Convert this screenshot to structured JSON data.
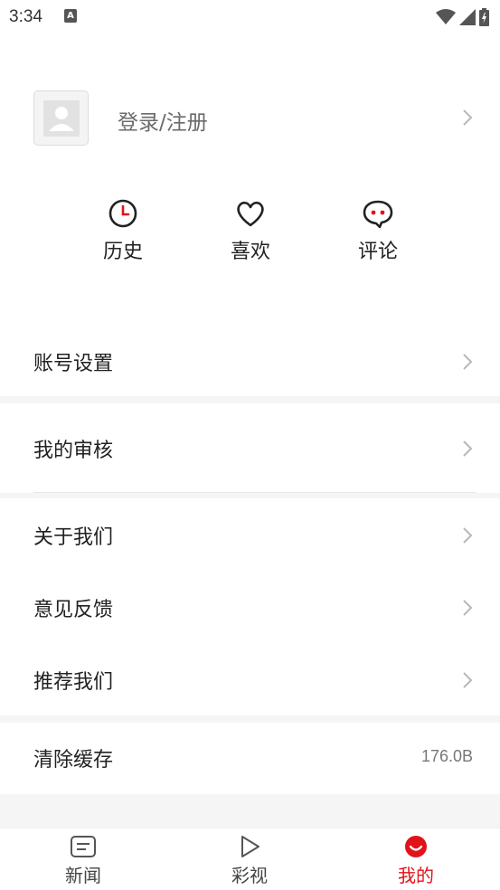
{
  "status_bar": {
    "time": "3:34",
    "notification_glyph": "A"
  },
  "profile": {
    "login_label": "登录/注册"
  },
  "quick_actions": [
    {
      "label": "历史",
      "icon": "clock-icon"
    },
    {
      "label": "喜欢",
      "icon": "heart-icon"
    },
    {
      "label": "评论",
      "icon": "comment-icon"
    }
  ],
  "menu": {
    "account_settings": "账号设置",
    "my_review": "我的审核",
    "about_us": "关于我们",
    "feedback": "意见反馈",
    "recommend_us": "推荐我们",
    "clear_cache": "清除缓存",
    "cache_size": "176.0B"
  },
  "tabs": [
    {
      "label": "新闻",
      "icon": "news-icon",
      "active": false
    },
    {
      "label": "彩视",
      "icon": "play-icon",
      "active": false
    },
    {
      "label": "我的",
      "icon": "profile-smile-icon",
      "active": true
    }
  ],
  "colors": {
    "accent": "#e0131b",
    "text": "#222222",
    "muted": "#6b6b6b",
    "separator": "#f5f5f5"
  }
}
